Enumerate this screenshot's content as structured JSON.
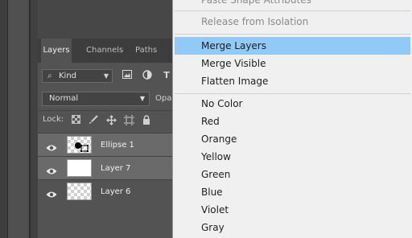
{
  "panel": {
    "tabs": [
      {
        "label": "Layers",
        "active": true
      },
      {
        "label": "Channels",
        "active": false
      },
      {
        "label": "Paths",
        "active": false
      }
    ],
    "filter": {
      "kind_label": "Kind",
      "icons": [
        "image-filter-icon",
        "adjustment-filter-icon",
        "type-filter-icon"
      ]
    },
    "blend_mode": "Normal",
    "opacity_label": "Opa",
    "lock_label": "Lock:",
    "lock_icons": [
      "lock-transparent-pixels-icon",
      "lock-image-pixels-icon",
      "lock-position-icon",
      "artboard-nesting-icon",
      "lock-all-icon"
    ],
    "layers": [
      {
        "name": "Ellipse 1",
        "selected": true,
        "thumb": "checker-ellipse"
      },
      {
        "name": "Layer 7",
        "selected": true,
        "thumb": "white"
      },
      {
        "name": "Layer 6",
        "selected": false,
        "thumb": "checker"
      }
    ]
  },
  "menu": {
    "items": [
      {
        "label": "Paste Shape Attributes",
        "disabled": true
      },
      {
        "label": "Release from Isolation",
        "disabled": true
      },
      {
        "label": "Merge Layers",
        "highlighted": true
      },
      {
        "label": "Merge Visible"
      },
      {
        "label": "Flatten Image"
      },
      {
        "label": "No Color"
      },
      {
        "label": "Red"
      },
      {
        "label": "Orange"
      },
      {
        "label": "Yellow"
      },
      {
        "label": "Green"
      },
      {
        "label": "Blue"
      },
      {
        "label": "Violet"
      },
      {
        "label": "Gray"
      }
    ]
  },
  "colors": {
    "menu_highlight": "#91c9f7",
    "panel_bg": "#535353",
    "selected_layer": "#6a6a6a"
  }
}
